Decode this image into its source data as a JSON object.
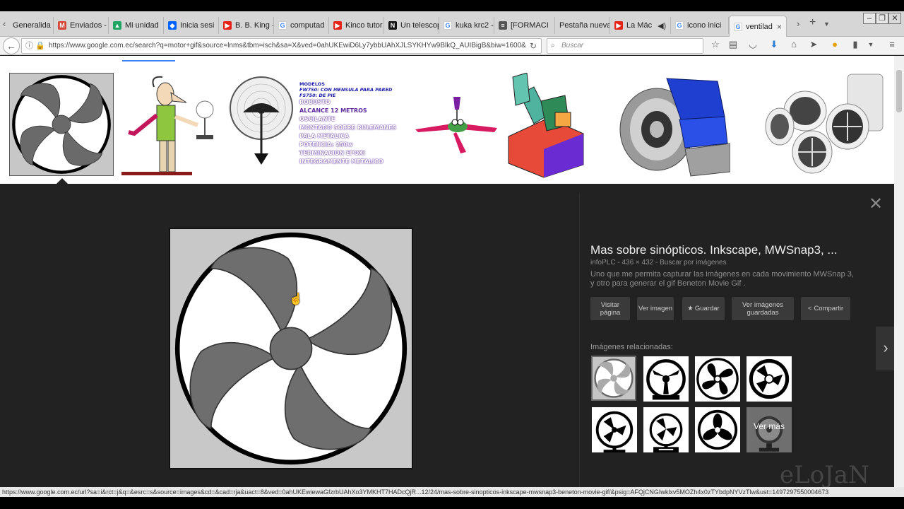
{
  "tabs": [
    {
      "label": "Generalida",
      "icon": "page-icon",
      "color": "#777777"
    },
    {
      "label": "Enviados -",
      "icon": "gmail-icon",
      "color": "#d44638"
    },
    {
      "label": "Mi unidad",
      "icon": "drive-icon",
      "color": "#1fa463"
    },
    {
      "label": "Inicia sesi",
      "icon": "dropbox-icon",
      "color": "#0061fe"
    },
    {
      "label": "B. B. King -",
      "icon": "youtube-icon",
      "color": "#e62117"
    },
    {
      "label": "computad",
      "icon": "google-icon",
      "color": "#4285f4"
    },
    {
      "label": "Kinco tutor",
      "icon": "youtube-icon",
      "color": "#e62117"
    },
    {
      "label": "Un telescop",
      "icon": "n-icon",
      "color": "#111111"
    },
    {
      "label": "kuka krc2 -",
      "icon": "google-icon",
      "color": "#4285f4"
    },
    {
      "label": "[FORMACI",
      "icon": "doc-icon",
      "color": "#555555"
    },
    {
      "label": "Pestaña nueva",
      "icon": "",
      "color": ""
    },
    {
      "label": "La Mác",
      "icon": "youtube-icon",
      "color": "#e62117"
    },
    {
      "label": "icono inici",
      "icon": "google-icon",
      "color": "#4285f4"
    },
    {
      "label": "ventilad",
      "icon": "google-icon",
      "color": "#4285f4"
    }
  ],
  "url": "https://www.google.com.ec/search?q=motor+gif&source=lnms&tbm=isch&sa=X&ved=0ahUKEwiD6Ly7ybbUAhXJLSYKHYw9BlkQ_AUIBigB&biw=1600&",
  "search_placeholder": "Buscar",
  "strip_text": {
    "t1": "MODELOS",
    "t2": "FW750: CON MENSULA PARA PARED",
    "t3": "FS750: DE PIE",
    "t4": "ROBUSTO",
    "t5": "ALCANCE 12 METROS",
    "t6": "OSCILANTE",
    "t7": "MONTADO SOBRE RULEMANES",
    "t8": "PALA METALICA",
    "t9": "POTENCIA: 250w",
    "t10": "TERMINACION EPOXI",
    "t11": "INTEGRAMENTE METALICO"
  },
  "panel": {
    "title": "Mas sobre sinópticos. Inkscape, MWSnap3, ...",
    "meta": "infoPLC - 436 × 432 - Buscar por imágenes",
    "description": "Uno que me permita capturar las imágenes en cada movimiento MWSnap 3, y otro para generar el gif Beneton Movie Gif .",
    "btn_visit": "Visitar página",
    "btn_view": "Ver imagen",
    "btn_save": "Guardar",
    "btn_saved": "Ver imágenes guardadas",
    "btn_share": "Compartir",
    "related_label": "Imágenes relacionadas:",
    "more_label": "Ver más"
  },
  "status_url": "https://www.google.com.ec/url?sa=i&rct=j&q=&esrc=s&source=images&cd=&cad=rja&uact=8&ved=0ahUKEwiewaGfzrbUAhXo3YMKHT7HADcQjR...12/24/mas-sobre-sinopticos-inkscape-mwsnap3-beneton-movie-gif/&psig=AFQjCNGIwklxv5MOZh4x0zTYbdpNYVzTlw&ust=1497297550004673",
  "watermark": "eLoJaN",
  "colors": {
    "accent": "#4285f4",
    "panel_bg": "#222222"
  }
}
